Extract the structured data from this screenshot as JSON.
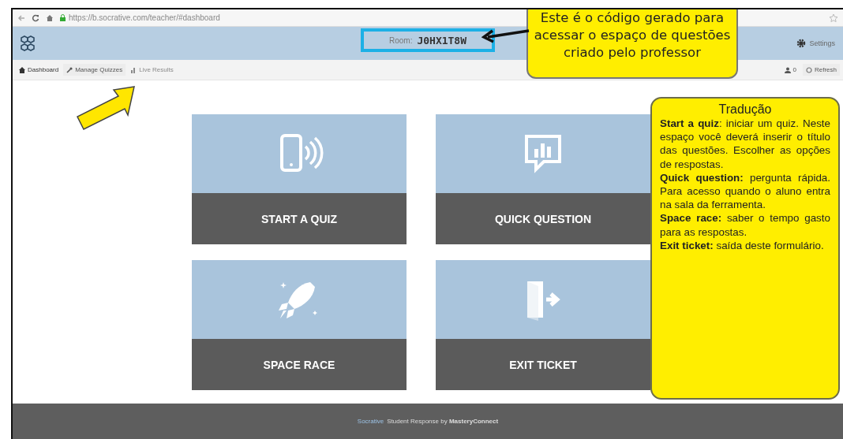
{
  "browser": {
    "url": "https://b.socrative.com/teacher/#dashboard"
  },
  "header": {
    "room_label": "Room:",
    "room_code": "J0HX1T8W",
    "settings": "Settings"
  },
  "nav": [
    {
      "label": "Dashboard",
      "kind": "home",
      "selected": true,
      "disabled": false
    },
    {
      "label": "Manage Quizzes",
      "kind": "wrench",
      "selected": false,
      "disabled": false
    },
    {
      "label": "Live Results",
      "kind": "chart",
      "selected": false,
      "disabled": true
    }
  ],
  "nav_right": {
    "count": "0",
    "refresh": "Refresh"
  },
  "cards": [
    {
      "label": "START A QUIZ",
      "kind": "phone"
    },
    {
      "label": "QUICK QUESTION",
      "kind": "chat"
    },
    {
      "label": "SPACE RACE",
      "kind": "rocket"
    },
    {
      "label": "EXIT TICKET",
      "kind": "exit"
    }
  ],
  "code_note": {
    "text": "Este é o código gerado para acessar o espaço de questões criado pelo professor"
  },
  "translation": {
    "title": "Tradução",
    "paragraphs": [
      "**Start a quiz**: iniciar um quiz. Neste espaço você deverá inserir o título das questões. Escolher as opções de respostas.",
      "**Quick question:** pergunta rápida. Para acesso quando o aluno entra na sala da ferramenta.",
      "**Space race:** saber o tempo gasto para as respostas.",
      "**Exit ticket:** saída deste formulário."
    ]
  },
  "footer": {
    "brand": "Socrative",
    "text": "Student Response by **MasteryConnect**"
  }
}
